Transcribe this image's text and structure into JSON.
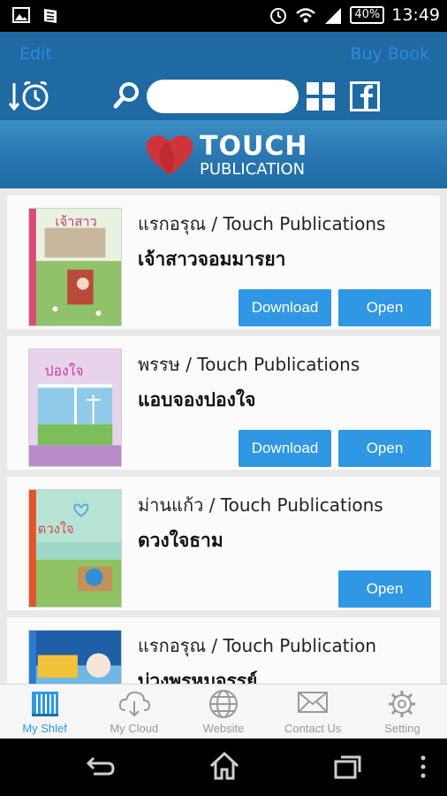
{
  "status_bar": {
    "time": "13:49",
    "battery": "40%"
  },
  "header": {
    "edit_label": "Edit",
    "buy_label": "Buy Book",
    "search_value": "",
    "search_placeholder": ""
  },
  "brand": {
    "line1": "TOUCH",
    "line2": "PUBLICATION"
  },
  "books": [
    {
      "author": "แรกอรุณ / Touch Publications",
      "title": "เจ้าสาวจอมมารยา",
      "download": "Download",
      "open": "Open"
    },
    {
      "author": "พรรษ / Touch Publications",
      "title": "แอบจองปองใจ",
      "download": "Download",
      "open": "Open"
    },
    {
      "author": "ม่านแก้ว / Touch Publications",
      "title": "ดวงใจธาม",
      "open": "Open"
    },
    {
      "author": "แรกอรุณ / Touch Publication",
      "title": "บ่วงพรหมจรรย์"
    }
  ],
  "tabs": [
    {
      "label": "My Shlef",
      "icon": "bookshelf-icon"
    },
    {
      "label": "My Cloud",
      "icon": "cloud-download-icon"
    },
    {
      "label": "Website",
      "icon": "globe-icon"
    },
    {
      "label": "Contact Us",
      "icon": "mail-icon"
    },
    {
      "label": "Setting",
      "icon": "gear-icon"
    }
  ],
  "colors": {
    "header": "#1f6aa3",
    "accent": "#2f97e3",
    "link": "#2c8ae0",
    "heart": "#d0343a"
  }
}
